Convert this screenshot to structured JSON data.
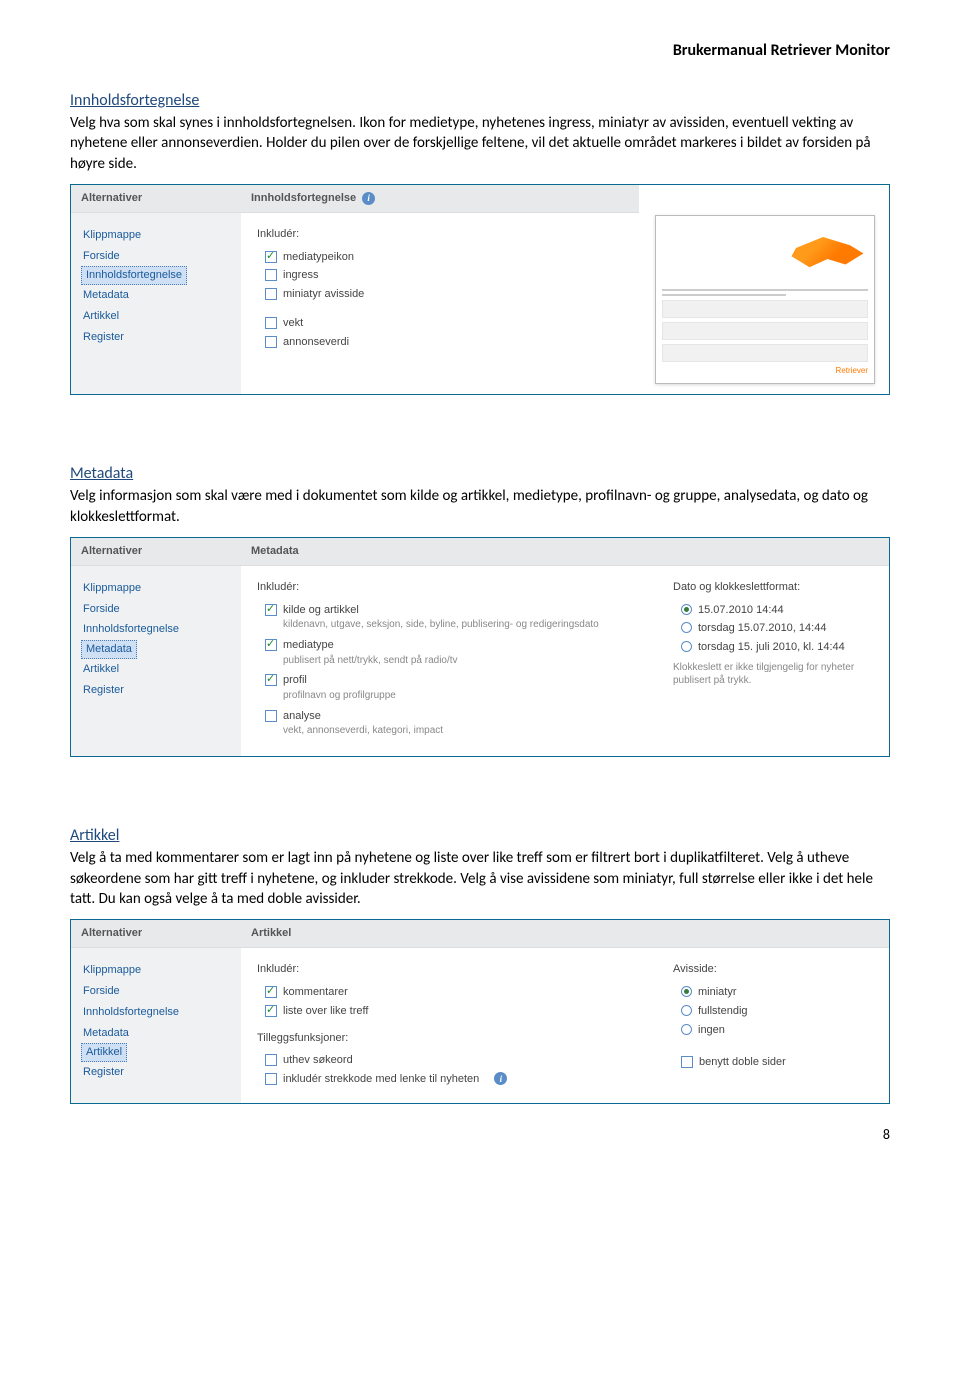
{
  "header": "Brukermanual Retriever Monitor",
  "sections": {
    "s1": {
      "heading": "Innholdsfortegnelse",
      "body": "Velg hva som skal synes i innholdsfortegnelsen. Ikon for medietype, nyhetenes ingress, miniatyr av avissiden, eventuell vekting av nyhetene eller annonseverdien. Holder du pilen over de forskjellige feltene, vil det aktuelle området markeres i bildet av forsiden på høyre side."
    },
    "s2": {
      "heading": "Metadata",
      "body": "Velg informasjon som skal være med i dokumentet som kilde og artikkel, medietype, profilnavn- og gruppe, analysedata, og dato og klokkeslettformat."
    },
    "s3": {
      "heading": "Artikkel",
      "body": "Velg å ta med kommentarer som er lagt inn på nyhetene og liste over like treff som er filtrert bort i duplikatfilteret. Velg å utheve søkeordene som har gitt treff i nyhetene, og inkluder strekkode. Velg å vise avissidene som miniatyr, full størrelse eller ikke i det hele tatt. Du kan også velge å ta med doble avissider."
    }
  },
  "sidebar": {
    "head": "Alternativer",
    "items": [
      "Klippmappe",
      "Forside",
      "Innholdsfortegnelse",
      "Metadata",
      "Artikkel",
      "Register"
    ]
  },
  "panel1": {
    "title": "Innholdsfortegnelse",
    "includeLabel": "Inkludér:",
    "checks": [
      {
        "label": "mediatypeikon",
        "checked": true
      },
      {
        "label": "ingress",
        "checked": false
      },
      {
        "label": "miniatyr avisside",
        "checked": false
      },
      {
        "label": "vekt",
        "checked": false
      },
      {
        "label": "annonseverdi",
        "checked": false
      }
    ],
    "brand": "Retriever"
  },
  "panel2": {
    "title": "Metadata",
    "includeLabel": "Inkludér:",
    "checks": [
      {
        "label": "kilde og artikkel",
        "checked": true,
        "desc": "kildenavn, utgave, seksjon, side, byline, publisering- og redigeringsdato"
      },
      {
        "label": "mediatype",
        "checked": true,
        "desc": "publisert på nett/trykk, sendt på radio/tv"
      },
      {
        "label": "profil",
        "checked": true,
        "desc": "profilnavn og profilgruppe"
      },
      {
        "label": "analyse",
        "checked": false,
        "desc": "vekt, annonseverdi, kategori, impact"
      }
    ],
    "dateHead": "Dato og klokkeslettformat:",
    "radios": [
      {
        "label": "15.07.2010 14:44",
        "checked": true
      },
      {
        "label": "torsdag 15.07.2010, 14:44",
        "checked": false
      },
      {
        "label": "torsdag 15. juli 2010, kl. 14:44",
        "checked": false
      }
    ],
    "note": "Klokkeslett er ikke tilgjengelig for nyheter publisert på trykk."
  },
  "panel3": {
    "title": "Artikkel",
    "includeLabel": "Inkludér:",
    "checks": [
      {
        "label": "kommentarer",
        "checked": true
      },
      {
        "label": "liste over like treff",
        "checked": true
      }
    ],
    "extraHead": "Tilleggsfunksjoner:",
    "extraChecks": [
      {
        "label": "uthev søkeord",
        "checked": false
      },
      {
        "label": "inkludér strekkode med lenke til nyheten",
        "checked": false
      }
    ],
    "rightHead": "Avisside:",
    "radios": [
      {
        "label": "miniatyr",
        "checked": true
      },
      {
        "label": "fullstendig",
        "checked": false
      },
      {
        "label": "ingen",
        "checked": false
      }
    ],
    "dbl": {
      "label": "benytt doble sider",
      "checked": false
    }
  },
  "pageNum": "8"
}
